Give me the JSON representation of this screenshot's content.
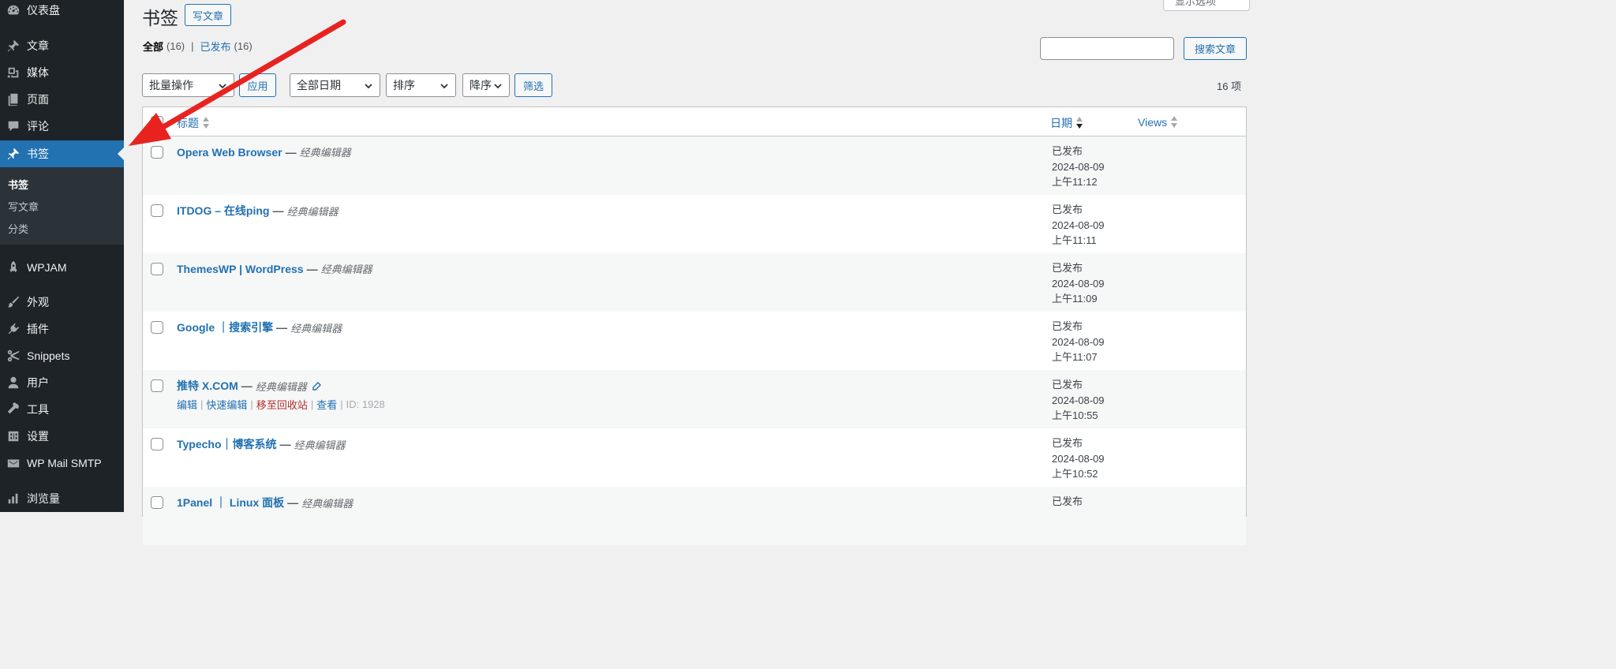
{
  "sidebar": {
    "items": [
      {
        "label": "仪表盘",
        "icon": "dashboard-icon"
      },
      {
        "label": "文章",
        "icon": "pin-icon"
      },
      {
        "label": "媒体",
        "icon": "media-icon"
      },
      {
        "label": "页面",
        "icon": "page-icon"
      },
      {
        "label": "评论",
        "icon": "comment-icon"
      },
      {
        "label": "书签",
        "icon": "pin-icon"
      },
      {
        "label": "WPJAM",
        "icon": "rocket-icon"
      },
      {
        "label": "外观",
        "icon": "brush-icon"
      },
      {
        "label": "插件",
        "icon": "plugin-icon"
      },
      {
        "label": "Snippets",
        "icon": "scissors-icon"
      },
      {
        "label": "用户",
        "icon": "user-icon"
      },
      {
        "label": "工具",
        "icon": "wrench-icon"
      },
      {
        "label": "设置",
        "icon": "settings-icon"
      },
      {
        "label": "WP Mail SMTP",
        "icon": "mail-icon"
      },
      {
        "label": "浏览量",
        "icon": "chart-icon"
      }
    ],
    "submenu": [
      "书签",
      "写文章",
      "分类"
    ]
  },
  "header": {
    "title": "书签",
    "add_new_label": "写文章",
    "screen_options_label": "显示选项"
  },
  "filters": {
    "all_label": "全部",
    "all_count": "(16)",
    "published_label": "已发布",
    "published_count": "(16)",
    "separator": "|",
    "search_button_label": "搜索文章",
    "bulk_actions": "批量操作",
    "apply_label": "应用",
    "date_filter": "全部日期",
    "orderby": "排序",
    "order": "降序",
    "filter_label": "筛选",
    "items_count": "16 项"
  },
  "table": {
    "columns": {
      "title": "标题",
      "date": "日期",
      "views": "Views"
    },
    "editor_label": "经典编辑器",
    "dash": "—",
    "rows": [
      {
        "title": "Opera Web Browser",
        "status": "已发布",
        "date": "2024-08-09",
        "time": "上午11:12"
      },
      {
        "title": "ITDOG – 在线ping",
        "status": "已发布",
        "date": "2024-08-09",
        "time": "上午11:11"
      },
      {
        "title": "ThemesWP | WordPress",
        "status": "已发布",
        "date": "2024-08-09",
        "time": "上午11:09"
      },
      {
        "title": "Google ｜搜索引擎",
        "status": "已发布",
        "date": "2024-08-09",
        "time": "上午11:07"
      },
      {
        "title": "推特 X.COM",
        "status": "已发布",
        "date": "2024-08-09",
        "time": "上午10:55"
      },
      {
        "title": "Typecho｜博客系统",
        "status": "已发布",
        "date": "2024-08-09",
        "time": "上午10:52"
      },
      {
        "title": "1Panel ｜ Linux 面板",
        "status": "已发布",
        "date": "",
        "time": ""
      }
    ],
    "row_actions": {
      "edit": "编辑",
      "quick_edit": "快速编辑",
      "trash": "移至回收站",
      "view": "查看",
      "id": "ID: 1928"
    }
  },
  "colors": {
    "sidebar_bg": "#1d2327",
    "accent": "#2271b1",
    "trash": "#b32d2e",
    "annotation_arrow": "#e8231f"
  }
}
